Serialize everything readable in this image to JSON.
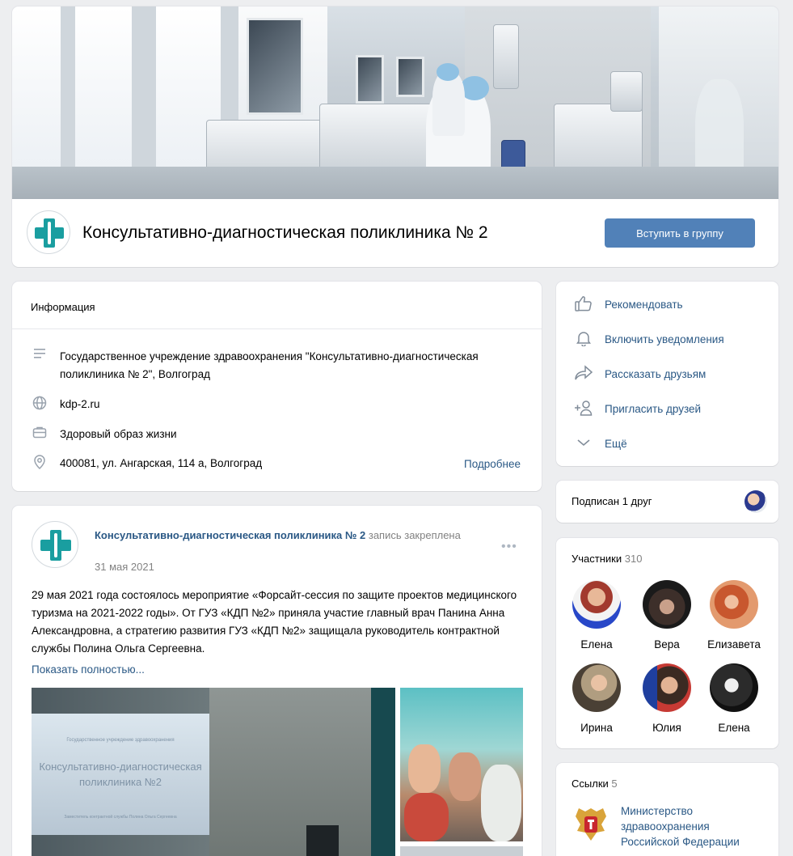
{
  "group": {
    "name": "Консультативно-диагностическая поликлиника № 2",
    "join_label": "Вступить в группу"
  },
  "info": {
    "title": "Информация",
    "description": "Государственное учреждение здравоохранения \"Консультативно-диагностическая поликлиника № 2\", Волгоград",
    "website": "kdp-2.ru",
    "category": "Здоровый образ жизни",
    "address": "400081, ул. Ангарская, 114 а, Волгоград",
    "more_label": "Подробнее"
  },
  "post": {
    "author": "Консультативно-диагностическая поликлиника № 2",
    "pinned_text": "запись закреплена",
    "date": "31 мая 2021",
    "menu_glyph": "•••",
    "text": "29 мая 2021 года состоялось мероприятие «Форсайт-сессия по защите проектов медицинского туризма на 2021-2022 годы». От ГУЗ «КДП №2» приняла участие главный врач Панина Анна Александровна, а стратегию развития ГУЗ «КДП №2» защищала руководитель контрактной службы Полина Ольга Сергеевна.",
    "show_more": "Показать полностью...",
    "slide_lines": [
      "Государственное учреждение здравоохранения",
      "Консультативно-диагностическая",
      "поликлиника №2",
      "Заместитель контрактной службы Полина Ольга Сергеевна"
    ]
  },
  "actions": [
    {
      "label": "Рекомендовать",
      "icon": "thumbs-up-icon"
    },
    {
      "label": "Включить уведомления",
      "icon": "bell-icon"
    },
    {
      "label": "Рассказать друзьям",
      "icon": "share-icon"
    },
    {
      "label": "Пригласить друзей",
      "icon": "add-person-icon"
    },
    {
      "label": "Ещё",
      "icon": "chevron-down-icon"
    }
  ],
  "friends": {
    "label": "Подписан 1 друг"
  },
  "members": {
    "title": "Участники",
    "count": "310",
    "list": [
      {
        "name": "Елена"
      },
      {
        "name": "Вера"
      },
      {
        "name": "Елизавета"
      },
      {
        "name": "Ирина"
      },
      {
        "name": "Юлия"
      },
      {
        "name": "Елена"
      }
    ]
  },
  "links": {
    "title": "Ссылки",
    "count": "5",
    "item": "Министерство здравоохранения Российской Федерации"
  },
  "colors": {
    "accent": "#5181b8",
    "link": "#2a5885",
    "logo_green": "#1a9ea0",
    "background": "#edeef0"
  }
}
